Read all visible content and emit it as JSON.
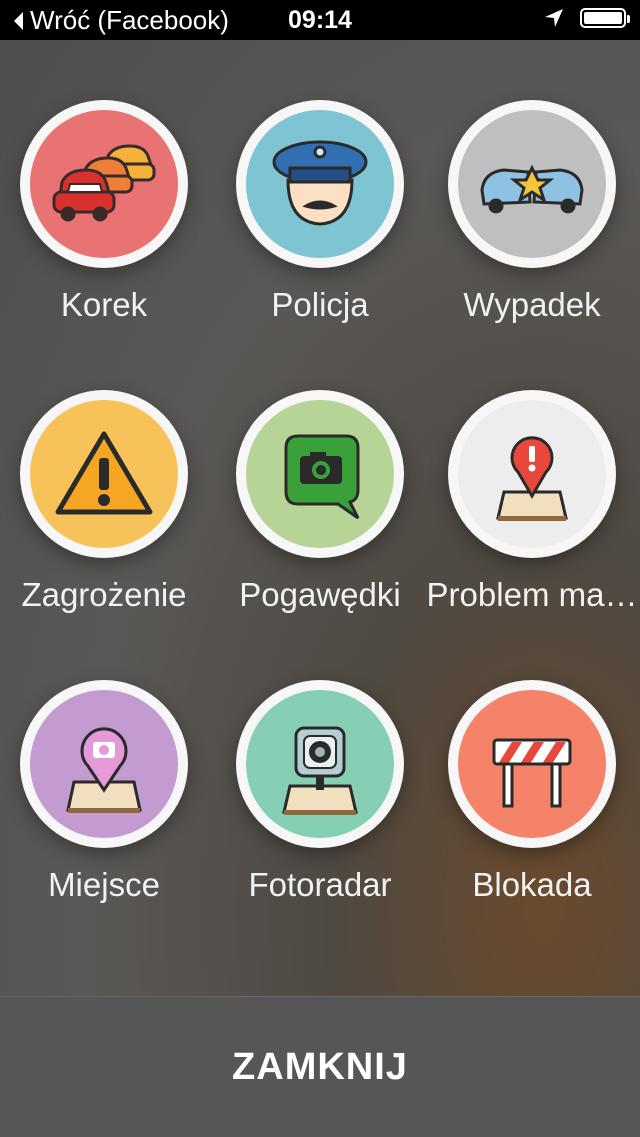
{
  "status_bar": {
    "back_label": "Wróć (Facebook)",
    "time": "09:14"
  },
  "tiles": [
    {
      "label": "Korek",
      "color": "#e97272",
      "icon": "traffic-jam-icon"
    },
    {
      "label": "Policja",
      "color": "#7ec4d2",
      "icon": "police-icon"
    },
    {
      "label": "Wypadek",
      "color": "#bfbfbf",
      "icon": "accident-icon"
    },
    {
      "label": "Zagrożenie",
      "color": "#f8c25a",
      "icon": "hazard-icon"
    },
    {
      "label": "Pogawędki",
      "color": "#b6d496",
      "icon": "chit-chat-icon"
    },
    {
      "label": "Problem ma…",
      "color": "#ededed",
      "icon": "map-problem-icon"
    },
    {
      "label": "Miejsce",
      "color": "#c39bd0",
      "icon": "place-icon"
    },
    {
      "label": "Fotoradar",
      "color": "#86cfb4",
      "icon": "speed-camera-icon"
    },
    {
      "label": "Blokada",
      "color": "#f5836a",
      "icon": "closure-icon"
    }
  ],
  "close_label": "ZAMKNIJ"
}
